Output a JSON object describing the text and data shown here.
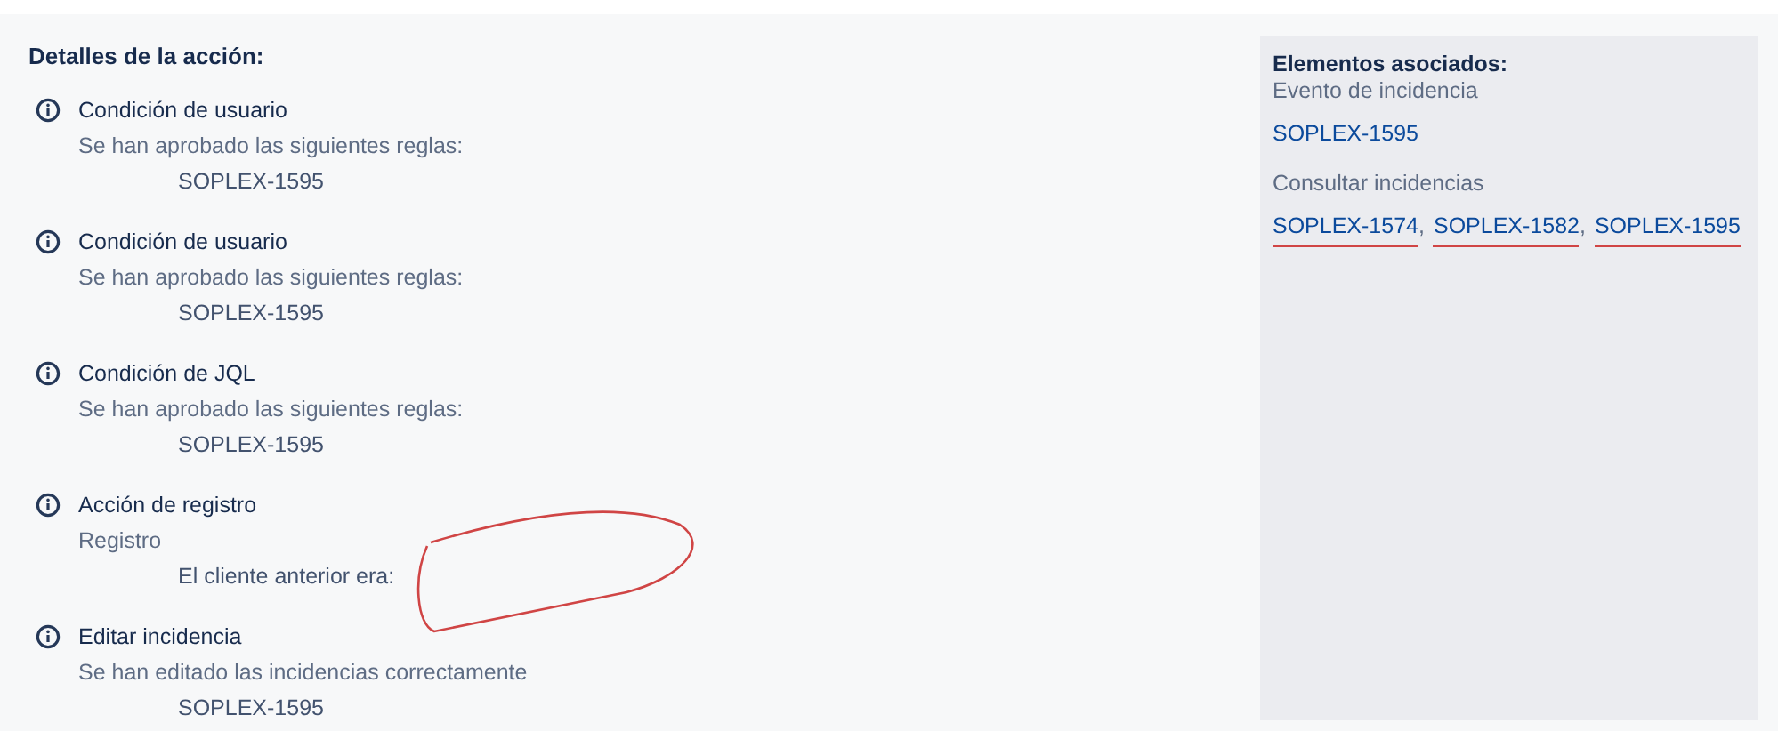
{
  "details": {
    "title": "Detalles de la acción:",
    "items": [
      {
        "title": "Condición de usuario",
        "description": "Se han aprobado las siguientes reglas:",
        "detail": "SOPLEX-1595"
      },
      {
        "title": "Condición de usuario",
        "description": "Se han aprobado las siguientes reglas:",
        "detail": "SOPLEX-1595"
      },
      {
        "title": "Condición de JQL",
        "description": "Se han aprobado las siguientes reglas:",
        "detail": "SOPLEX-1595"
      },
      {
        "title": "Acción de registro",
        "description": "Registro",
        "detail": "El cliente anterior era:"
      },
      {
        "title": "Editar incidencia",
        "description": "Se han editado las incidencias correctamente",
        "detail": "SOPLEX-1595"
      }
    ]
  },
  "related": {
    "title": "Elementos asociados:",
    "separator": ",",
    "groups": [
      {
        "label": "Evento de incidencia",
        "links": [
          {
            "text": "SOPLEX-1595",
            "underlined": false
          }
        ]
      },
      {
        "label": "Consultar incidencias",
        "links": [
          {
            "text": "SOPLEX-1574",
            "underlined": true
          },
          {
            "text": "SOPLEX-1582",
            "underlined": true
          },
          {
            "text": "SOPLEX-1595",
            "underlined": true
          }
        ]
      }
    ]
  }
}
